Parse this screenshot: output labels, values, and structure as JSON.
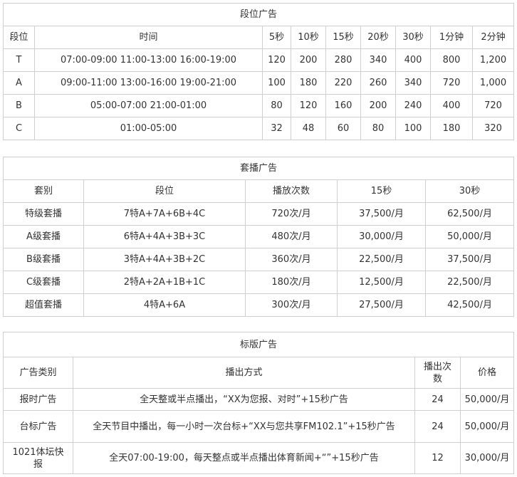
{
  "t1": {
    "title": "段位广告",
    "headers": [
      "段位",
      "时间",
      "5秒",
      "10秒",
      "15秒",
      "20秒",
      "30秒",
      "1分钟",
      "2分钟"
    ],
    "rows": [
      [
        "T",
        "07:00-09:00 11:00-13:00 16:00-19:00",
        "120",
        "200",
        "280",
        "340",
        "400",
        "800",
        "1,200"
      ],
      [
        "A",
        "09:00-11:00 13:00-16:00 19:00-21:00",
        "100",
        "180",
        "220",
        "260",
        "340",
        "720",
        "1,000"
      ],
      [
        "B",
        "05:00-07:00 21:00-01:00",
        "80",
        "120",
        "160",
        "200",
        "240",
        "400",
        "720"
      ],
      [
        "C",
        "01:00-05:00",
        "32",
        "48",
        "60",
        "80",
        "100",
        "180",
        "320"
      ]
    ]
  },
  "t2": {
    "title": "套播广告",
    "headers": [
      "套别",
      "段位",
      "播放次数",
      "15秒",
      "30秒"
    ],
    "rows": [
      [
        "特级套播",
        "7特A+7A+6B+4C",
        "720次/月",
        "37,500/月",
        "62,500/月"
      ],
      [
        "A级套播",
        "6特A+4A+3B+3C",
        "480次/月",
        "30,000/月",
        "50,000/月"
      ],
      [
        "B级套播",
        "3特A+4A+3B+2C",
        "360次/月",
        "22,500/月",
        "37,500/月"
      ],
      [
        "C级套播",
        "2特A+2A+1B+1C",
        "180次/月",
        "12,500/月",
        "22,500/月"
      ],
      [
        "超值套播",
        "4特A+6A",
        "300次/月",
        "27,500/月",
        "42,500/月"
      ]
    ]
  },
  "t3": {
    "title": "标版广告",
    "headers": [
      "广告类别",
      "播出方式",
      "播出次数",
      "价格"
    ],
    "rows": [
      [
        "报时广告",
        "全天整或半点播出，“XX为您报、对时”+15秒广告",
        "24",
        "50,000/月"
      ],
      [
        "台标广告",
        "全天节目中播出，每一小时一次台标+“XX与您共享FM102.1”+15秒广告",
        "24",
        "50,000/月"
      ],
      [
        "1021体坛快报",
        "全天07:00-19:00，每天整点或半点播出体育新闻+“”+15秒广告",
        "12",
        "30,000/月"
      ]
    ]
  }
}
